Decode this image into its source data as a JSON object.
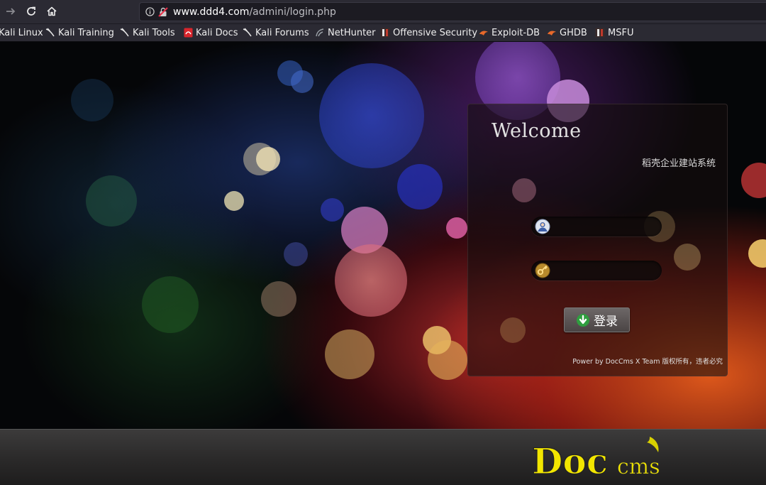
{
  "browser": {
    "url_host": "www.ddd4.com",
    "url_path": "/admini/login.php",
    "bookmarks": [
      {
        "label": "Kali Linux"
      },
      {
        "label": "Kali Training"
      },
      {
        "label": "Kali Tools"
      },
      {
        "label": "Kali Docs"
      },
      {
        "label": "Kali Forums"
      },
      {
        "label": "NetHunter"
      },
      {
        "label": "Offensive Security"
      },
      {
        "label": "Exploit-DB"
      },
      {
        "label": "GHDB"
      },
      {
        "label": "MSFU"
      }
    ]
  },
  "login": {
    "welcome": "Welcome",
    "subtitle": "稻壳企业建站系统",
    "username_value": "",
    "password_value": "",
    "login_label": "登录",
    "powered_by": "Power by DocCms X  Team 版权所有，违者必究"
  },
  "footer": {
    "logo_text": "Doc",
    "logo_suffix": "cms"
  },
  "colors": {
    "logo_yellow": "#f2e600",
    "accent_green": "#3fb34f"
  }
}
